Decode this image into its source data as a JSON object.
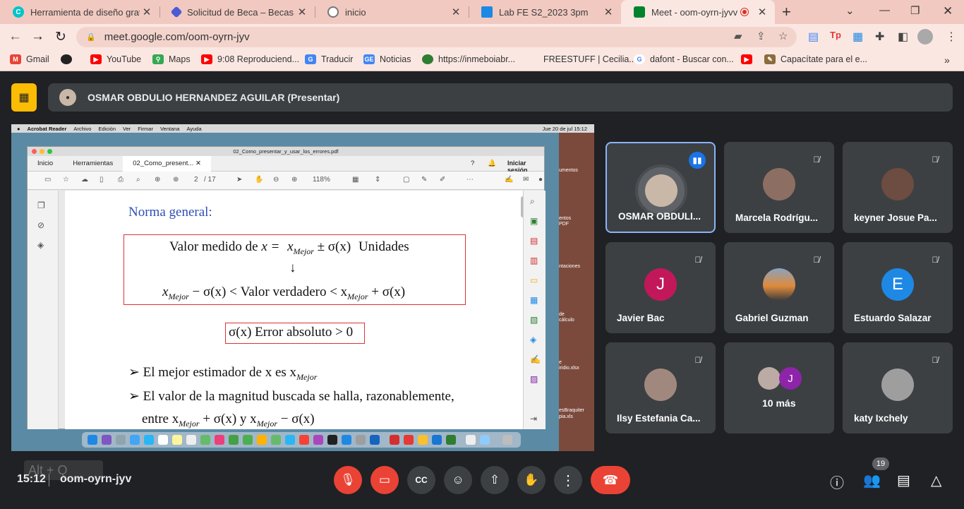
{
  "browser": {
    "tabs": [
      {
        "title": "Herramienta de diseño gratu",
        "icon": "canva-icon",
        "color": "#00c4cc"
      },
      {
        "title": "Solicitud de Beca – Becas US",
        "icon": "diamond-icon",
        "color": "#4a5bd4"
      },
      {
        "title": "inicio",
        "icon": "globe-icon",
        "color": "#777777"
      },
      {
        "title": "Lab FE S2_2023 3pm",
        "icon": "classroom-icon",
        "color": "#1e88e5"
      },
      {
        "title": "Meet - oom-oyrn-jyvv",
        "icon": "meet-icon",
        "color": "#00832d"
      }
    ],
    "url": "meet.google.com/oom-oyrn-jyv",
    "bookmarks": [
      {
        "label": "Gmail",
        "icon": "gmail-icon",
        "color": "#ea4335"
      },
      {
        "label": "",
        "icon": "music-icon",
        "color": "#222222"
      },
      {
        "label": "YouTube",
        "icon": "youtube-icon",
        "color": "#ff0000"
      },
      {
        "label": "Maps",
        "icon": "maps-icon",
        "color": "#34a853"
      },
      {
        "label": "9:08 Reproduciend...",
        "icon": "youtube-icon",
        "color": "#ff0000"
      },
      {
        "label": "Traducir",
        "icon": "translate-icon",
        "color": "#4285f4"
      },
      {
        "label": "Noticias",
        "icon": "news-icon",
        "color": "#4285f4"
      },
      {
        "label": "https://inmeboiabr...",
        "icon": "globe-icon",
        "color": "#2e7d32"
      },
      {
        "label": "FREESTUFF | Cecilia...",
        "icon": "blank-icon",
        "color": "#fbe7e2"
      },
      {
        "label": "dafont - Buscar con...",
        "icon": "google-icon",
        "color": "#4285f4"
      },
      {
        "label": "",
        "icon": "youtube-icon",
        "color": "#ff0000"
      },
      {
        "label": "Capacítate para el e...",
        "icon": "edit-icon",
        "color": "#8a6d3b"
      }
    ]
  },
  "meet": {
    "presenter_title": "OSMAR OBDULIO HERNANDEZ AGUILAR (Presentar)",
    "clock": "15:12",
    "meeting_code": "oom-oyrn-jyv",
    "participant_count": "19",
    "overlay_hint": "Alt + Q",
    "tiles": [
      {
        "name": "OSMAR OBDULI...",
        "avatar": "",
        "color": "#c9b8a8",
        "speaking": true
      },
      {
        "name": "Marcela Rodrígu...",
        "avatar": "",
        "color": "#8d6e63",
        "speaking": false
      },
      {
        "name": "keyner Josue Pa...",
        "avatar": "",
        "color": "#6d4c41",
        "speaking": false
      },
      {
        "name": "Javier Bac",
        "avatar": "J",
        "color": "#c2185b",
        "speaking": false
      },
      {
        "name": "Gabriel Guzman",
        "avatar": "",
        "color": "#e08a3c",
        "speaking": false
      },
      {
        "name": "Estuardo Salazar",
        "avatar": "E",
        "color": "#1e88e5",
        "speaking": false
      },
      {
        "name": "Ilsy Estefania Ca...",
        "avatar": "",
        "color": "#a1887f",
        "speaking": false
      },
      {
        "name": "10 más",
        "avatar": "J",
        "color": "#8e24aa",
        "speaking": false
      },
      {
        "name": "katy Ixchely",
        "avatar": "",
        "color": "#9e9e9e",
        "speaking": false
      }
    ]
  },
  "shared": {
    "mac_menu": [
      "Acrobat Reader",
      "Archivo",
      "Edición",
      "Ver",
      "Firmar",
      "Ventana",
      "Ayuda"
    ],
    "mac_time": "Jue 20 de jul 15:12",
    "pdf_filename": "02_Como_presentar_y_usar_los_errores.pdf",
    "pdf_tabs": [
      "Inicio",
      "Herramientas",
      "02_Como_present..."
    ],
    "signin": "Iniciar sesión",
    "page_current": "2",
    "page_total": "/ 17",
    "zoom": "118%",
    "desktop_labels": [
      "umentos",
      "entos PDF",
      "ntaciones",
      "de cálculo",
      "e iridio.xlsx",
      "esBraquiter",
      "pia.xls"
    ],
    "page": {
      "heading": "Norma general:",
      "line1_a": "Valor medido de",
      "line1_b": "x =",
      "line1_c": "x",
      "line1_sub": "Mejor",
      "line1_d": "± σ(x)",
      "line1_e": "Unidades",
      "arrow": "↓",
      "line2_a": "x",
      "line2_sub": "Mejor",
      "line2_b": "− σ(x) <  Valor verdadero  < x",
      "line2_sub2": "Mejor",
      "line2_c": "+ σ(x)",
      "box2": "σ(x)  Error absoluto > 0",
      "bullet1": "El mejor estimador de x es x",
      "bullet1_sub": "Mejor",
      "bullet2": "El valor de la magnitud buscada se halla, razonablemente,",
      "bullet3_a": "entre  x",
      "bullet3_sub": "Mejor",
      "bullet3_b": "+ σ(x)  y  x",
      "bullet3_sub2": "Mejor",
      "bullet3_c": "− σ(x)"
    }
  }
}
